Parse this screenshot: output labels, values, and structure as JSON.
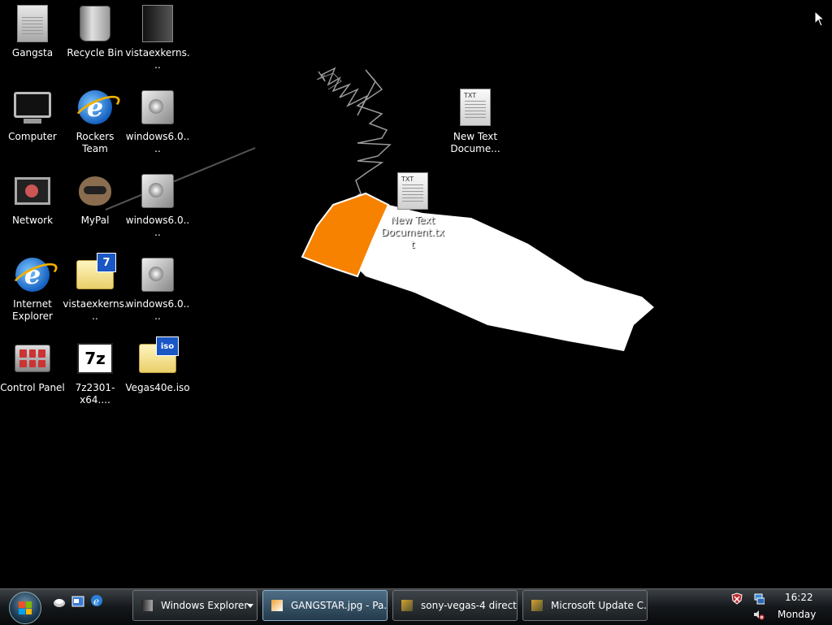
{
  "desktop": {
    "icons": [
      {
        "label": "Gangsta",
        "icon": "gangsta-doc-icon"
      },
      {
        "label": "Recycle Bin",
        "icon": "recycle-bin-icon"
      },
      {
        "label": "vistaexkerns...",
        "icon": "dark-folder-icon"
      },
      {
        "label": "Computer",
        "icon": "computer-icon"
      },
      {
        "label": "Rockers Team",
        "icon": "ie-shortcut-icon"
      },
      {
        "label": "windows6.0....",
        "icon": "setup-icon"
      },
      {
        "label": "New Text Docume...",
        "icon": "text-document-icon",
        "tag": "TXT"
      },
      {
        "label": "Network",
        "icon": "network-icon"
      },
      {
        "label": "MyPal",
        "icon": "mypal-icon"
      },
      {
        "label": "windows6.0....",
        "icon": "setup-icon"
      },
      {
        "label": "New Text Document.txt",
        "icon": "text-document-icon",
        "tag": "TXT"
      },
      {
        "label": "Internet Explorer",
        "icon": "internet-explorer-icon"
      },
      {
        "label": "vistaexkerns...",
        "icon": "7zip-folder-icon",
        "badge": "7"
      },
      {
        "label": "windows6.0....",
        "icon": "setup-icon"
      },
      {
        "label": "Control Panel",
        "icon": "control-panel-icon"
      },
      {
        "label": "7z2301-x64....",
        "icon": "7zip-installer-icon",
        "glyph": "7z"
      },
      {
        "label": "Vegas40e.iso",
        "icon": "iso-file-icon",
        "badge": "iso"
      }
    ]
  },
  "taskbar": {
    "tasks": [
      {
        "label": "Windows Explorer",
        "active": false
      },
      {
        "label": "GANGSTAR.jpg - Pa...",
        "active": true
      },
      {
        "label": "sony-vegas-4 direct...",
        "active": false
      },
      {
        "label": "Microsoft Update C...",
        "active": false
      }
    ],
    "clock": {
      "time": "16:22",
      "day": "Monday"
    }
  },
  "colors": {
    "cigarette_filter": "#f78200",
    "cigarette_paper": "#ffffff",
    "smoke": "#9a9a9a"
  }
}
